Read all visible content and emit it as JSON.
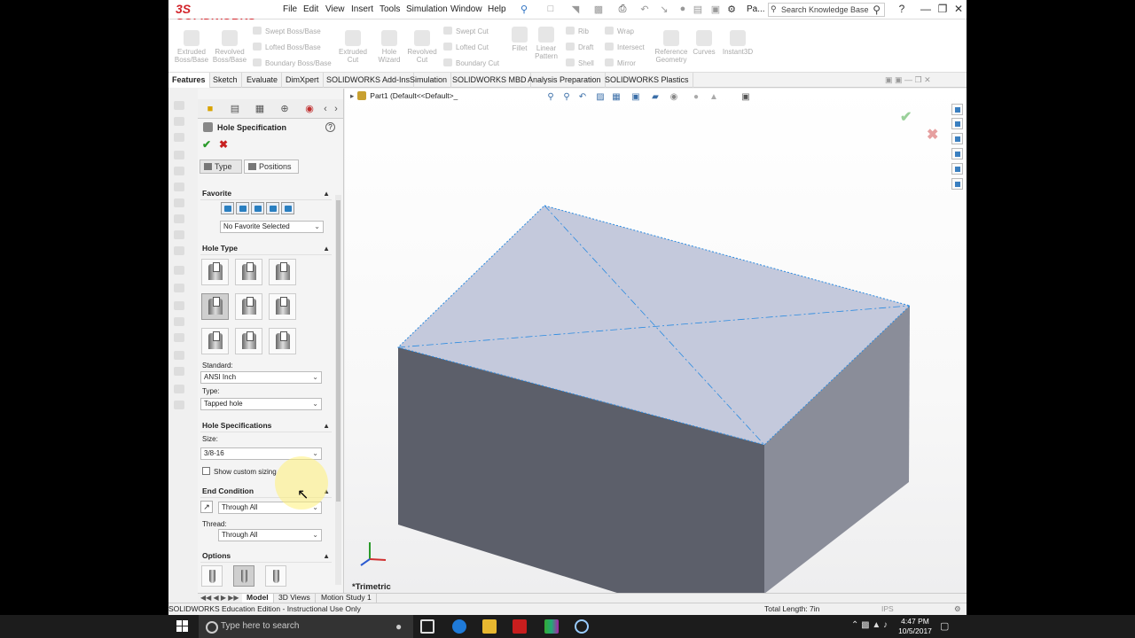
{
  "app": {
    "logo": "SOLIDWORKS",
    "logo_ds": "3S"
  },
  "menu": [
    "File",
    "Edit",
    "View",
    "Insert",
    "Tools",
    "Simulation",
    "Window",
    "Help"
  ],
  "quick_access": {
    "truncated": "Pa..."
  },
  "search": {
    "placeholder": "Search Knowledge Base"
  },
  "ribbon": {
    "large": [
      {
        "label": "Extruded\nBoss/Base"
      },
      {
        "label": "Revolved\nBoss/Base"
      },
      {
        "label": "Extruded\nCut"
      },
      {
        "label": "Hole\nWizard"
      },
      {
        "label": "Revolved\nCut"
      },
      {
        "label": "Fillet"
      },
      {
        "label": "Linear\nPattern"
      },
      {
        "label": "Reference\nGeometry"
      },
      {
        "label": "Curves"
      },
      {
        "label": "Instant3D"
      }
    ],
    "small": [
      "Swept Boss/Base",
      "Lofted Boss/Base",
      "Boundary Boss/Base",
      "Swept Cut",
      "Lofted Cut",
      "Boundary Cut",
      "Rib",
      "Draft",
      "Shell",
      "Wrap",
      "Intersect",
      "Mirror"
    ]
  },
  "tabs": [
    "Features",
    "Sketch",
    "Evaluate",
    "DimXpert",
    "SOLIDWORKS Add-Ins",
    "Simulation",
    "SOLIDWORKS MBD",
    "Analysis Preparation",
    "SOLIDWORKS Plastics"
  ],
  "pm": {
    "title": "Hole Specification",
    "tab_type": "Type",
    "tab_positions": "Positions",
    "favorite": {
      "header": "Favorite",
      "value": "No Favorite Selected"
    },
    "hole_type": {
      "header": "Hole Type"
    },
    "standard": {
      "label": "Standard:",
      "value": "ANSI Inch"
    },
    "type": {
      "label": "Type:",
      "value": "Tapped hole"
    },
    "hole_specs": {
      "header": "Hole Specifications",
      "size_label": "Size:",
      "size_value": "3/8-16",
      "custom_sizing": "Show custom sizing"
    },
    "end_condition": {
      "header": "End Condition",
      "value": "Through All"
    },
    "thread": {
      "label": "Thread:",
      "value": "Through All"
    },
    "options": {
      "header": "Options"
    }
  },
  "viewport": {
    "tree_label": "Part1  (Default<<Default>_",
    "view_label": "*Trimetric"
  },
  "bottom_tabs": [
    "Model",
    "3D Views",
    "Motion Study 1"
  ],
  "status": {
    "left": "SOLIDWORKS Education Edition - Instructional Use Only",
    "total_length": "Total Length: 7in",
    "units": "IPS"
  },
  "taskbar": {
    "search_placeholder": "Type here to search",
    "time": "4:47 PM",
    "date": "10/5/2017"
  },
  "colors": {
    "face_top": "#c4c9dc",
    "face_front": "#5c5f6a",
    "face_side": "#8a8d99",
    "sketch": "#2a8ae0",
    "accent_red": "#d2232a"
  }
}
